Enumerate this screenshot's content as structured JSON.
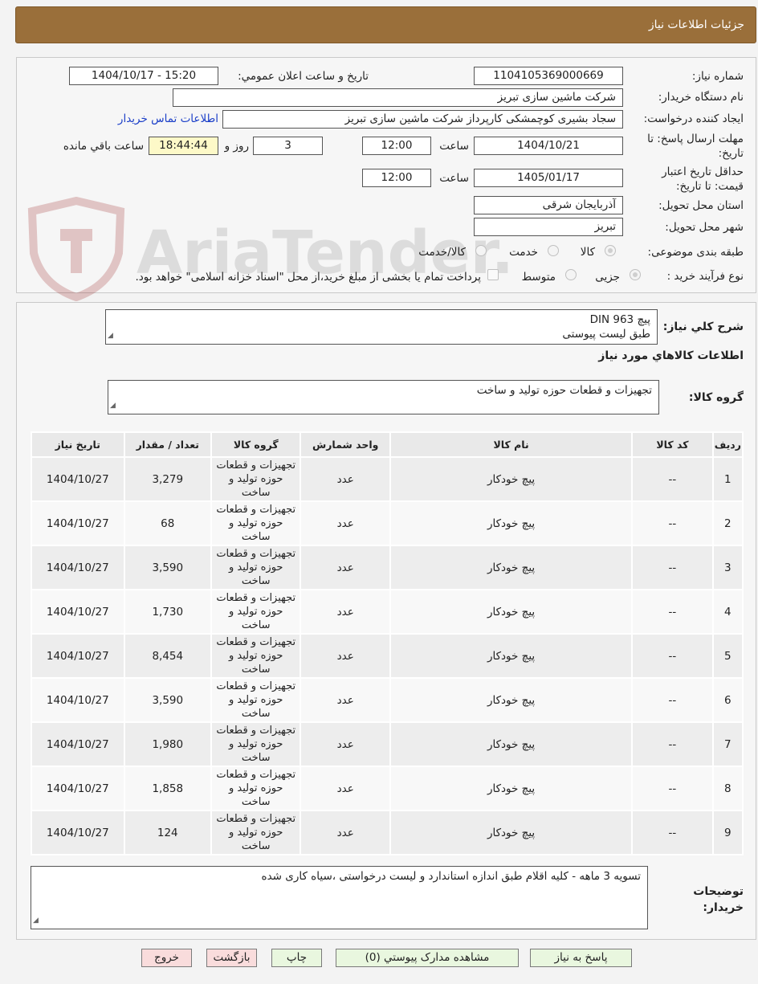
{
  "page": {
    "title": "جزئيات اطلاعات نياز"
  },
  "info": {
    "need_number_label": "شماره نیاز:",
    "need_number": "1104105369000669",
    "announce_label": "تاريخ و ساعت اعلان عمومي:",
    "announce_value": "1404/10/17 - 15:20",
    "buyer_org_label": "نام دستگاه خریدار:",
    "buyer_org": "شرکت ماشین سازی تبریز",
    "creator_label": "ايجاد کننده درخواست:",
    "creator": "سجاد بشیری کوچمشکی کارپرداز شرکت ماشین سازی تبریز",
    "contact_link": "اطلاعات تماس خریدار",
    "deadline_label": "مهلت ارسال پاسخ: تا تاریخ:",
    "deadline_date": "1404/10/21",
    "time_label": "ساعت",
    "deadline_time": "12:00",
    "days_value": "3",
    "days_label": "روز و",
    "remaining_time": "18:44:44",
    "remaining_label": "ساعت باقي مانده",
    "validity_label": "حداقل تاریخ اعتبار قیمت: تا تاریخ:",
    "validity_date": "1405/01/17",
    "validity_time": "12:00",
    "province_label": "استان محل تحویل:",
    "province": "آذربایجان شرقی",
    "city_label": "شهر محل تحویل:",
    "city": "تبریز",
    "category_label": "طبقه بندی موضوعی:",
    "category_options": [
      "کالا",
      "خدمت",
      "کالا/خدمت"
    ],
    "process_label": "نوع فرآیند خرید :",
    "process_options": [
      "جزیی",
      "متوسط"
    ],
    "payment_note": "پرداخت تمام یا بخشی از مبلغ خرید،از محل \"اسناد خزانه اسلامی\" خواهد بود."
  },
  "description": {
    "label": "شرح کلي نياز:",
    "line1": "پیچ  DIN  963",
    "line2": "طبق لیست پیوستی"
  },
  "goods": {
    "section_title": "اطلاعات کالاهاي مورد نياز",
    "group_label": "گروه کالا:",
    "group_value": "تجهیزات و قطعات حوزه تولید و ساخت"
  },
  "table": {
    "headers": [
      "رديف",
      "کد کالا",
      "نام کالا",
      "واحد شمارش",
      "گروه کالا",
      "تعداد / مقدار",
      "تاریخ نیاز"
    ],
    "rows": [
      {
        "row": "1",
        "code": "--",
        "name": "پیچ خودکار",
        "unit": "عدد",
        "group": "تجهیزات و قطعات حوزه تولید و ساخت",
        "qty": "3,279",
        "date": "1404/10/27"
      },
      {
        "row": "2",
        "code": "--",
        "name": "پیچ خودکار",
        "unit": "عدد",
        "group": "تجهیزات و قطعات حوزه تولید و ساخت",
        "qty": "68",
        "date": "1404/10/27"
      },
      {
        "row": "3",
        "code": "--",
        "name": "پیچ خودکار",
        "unit": "عدد",
        "group": "تجهیزات و قطعات حوزه تولید و ساخت",
        "qty": "3,590",
        "date": "1404/10/27"
      },
      {
        "row": "4",
        "code": "--",
        "name": "پیچ خودکار",
        "unit": "عدد",
        "group": "تجهیزات و قطعات حوزه تولید و ساخت",
        "qty": "1,730",
        "date": "1404/10/27"
      },
      {
        "row": "5",
        "code": "--",
        "name": "پیچ خودکار",
        "unit": "عدد",
        "group": "تجهیزات و قطعات حوزه تولید و ساخت",
        "qty": "8,454",
        "date": "1404/10/27"
      },
      {
        "row": "6",
        "code": "--",
        "name": "پیچ خودکار",
        "unit": "عدد",
        "group": "تجهیزات و قطعات حوزه تولید و ساخت",
        "qty": "3,590",
        "date": "1404/10/27"
      },
      {
        "row": "7",
        "code": "--",
        "name": "پیچ خودکار",
        "unit": "عدد",
        "group": "تجهیزات و قطعات حوزه تولید و ساخت",
        "qty": "1,980",
        "date": "1404/10/27"
      },
      {
        "row": "8",
        "code": "--",
        "name": "پیچ خودکار",
        "unit": "عدد",
        "group": "تجهیزات و قطعات حوزه تولید و ساخت",
        "qty": "1,858",
        "date": "1404/10/27"
      },
      {
        "row": "9",
        "code": "--",
        "name": "پیچ خودکار",
        "unit": "عدد",
        "group": "تجهیزات و قطعات حوزه تولید و ساخت",
        "qty": "124",
        "date": "1404/10/27"
      }
    ]
  },
  "notes": {
    "label": "توضیحات خریدار:",
    "value": "تسویه 3 ماهه - کلیه اقلام طبق اندازه استاندارد و لیست درخواستی ،سیاه کاری شده"
  },
  "buttons": {
    "reply": "پاسخ به نياز",
    "attachments": "مشاهده مدارک پيوستي (0)",
    "print": "چاپ",
    "back": "بازگشت",
    "exit": "خروج"
  },
  "watermark": {
    "text": "AriaTender.neT"
  },
  "colors": {
    "header": "#9a6f3a",
    "link": "#1a3ec8",
    "button_green": "#e9f7df",
    "button_red": "#f9dcdc"
  }
}
